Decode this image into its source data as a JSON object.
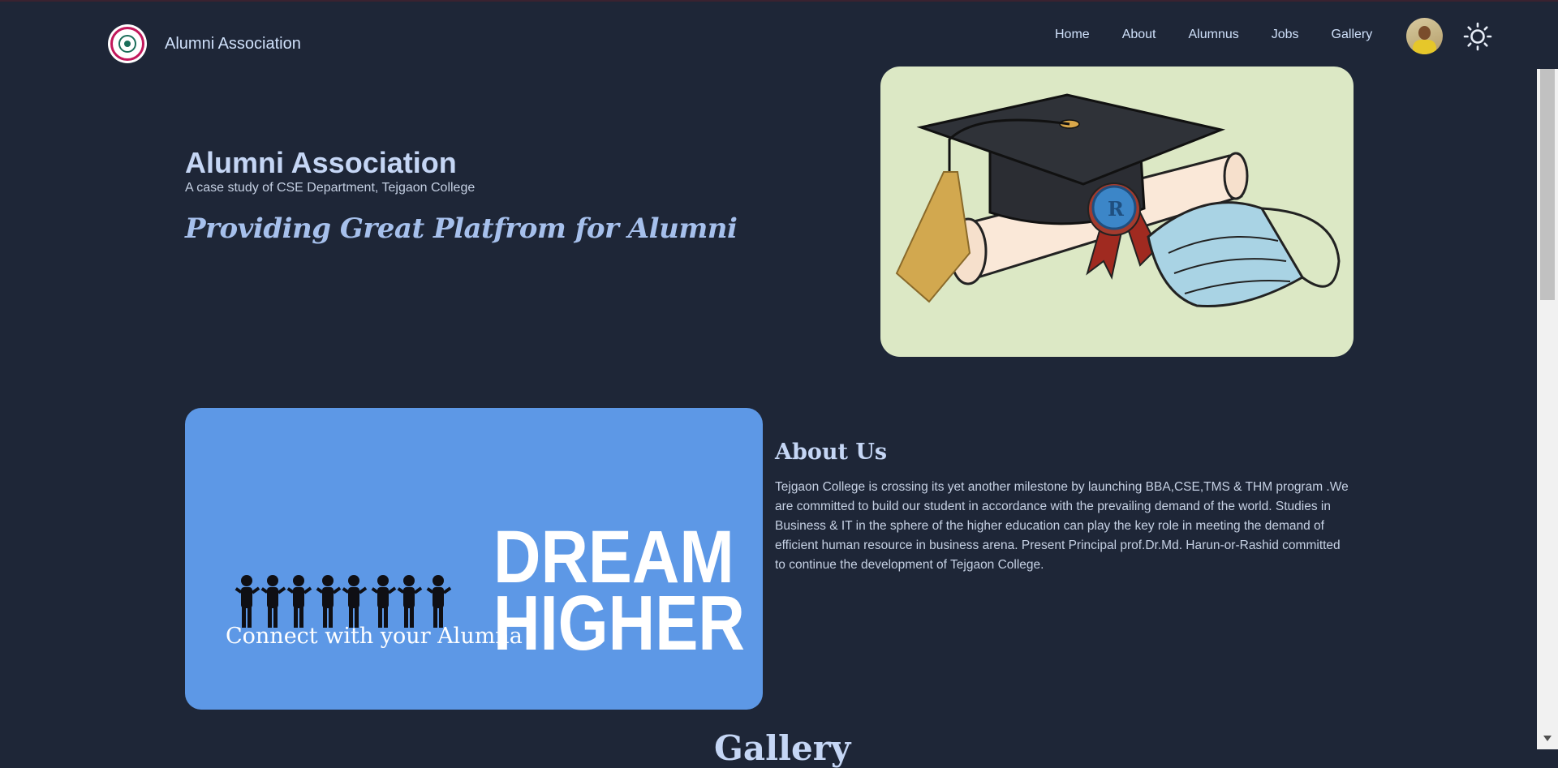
{
  "navbar": {
    "brand_name": "Alumni Association",
    "links": [
      "Home",
      "About",
      "Alumnus",
      "Jobs",
      "Gallery"
    ]
  },
  "hero": {
    "title": "Alumni Association",
    "subtitle": "A case study of CSE Department, Tejgaon College",
    "tagline": "Providing Great Platfrom for Alumni"
  },
  "about": {
    "image_caption": "Connect with your Alumna",
    "image_word_1": "DREAM",
    "image_word_2": "HIGHER",
    "heading": "About Us",
    "text": "Tejgaon College is crossing its yet another milestone by launching BBA,CSE,TMS & THM program .We are committed to build our student in accordance with the prevailing demand of the world. Studies in Business & IT in the sphere of the higher education can play the key role in meeting the demand of efficient human resource in business arena. Present Principal prof.Dr.Md. Harun-or-Rashid committed to continue the development of Tejgaon College."
  },
  "gallery": {
    "heading": "Gallery"
  },
  "colors": {
    "background": "#1e2637",
    "accent_blue": "#5d98e6",
    "hero_image_bg": "#dce8c5"
  },
  "icons": [
    "college-logo-icon",
    "avatar",
    "sun-icon",
    "graduation-cap-icon",
    "people-icon"
  ]
}
